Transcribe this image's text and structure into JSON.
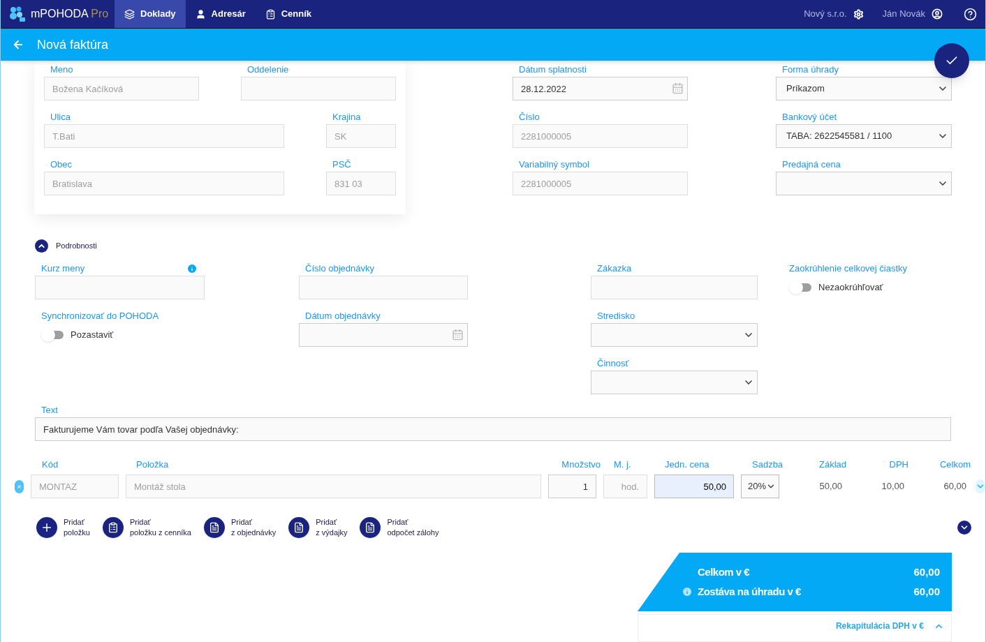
{
  "nav": {
    "logo": {
      "name": "mPOHODA",
      "suffix": "Pro"
    },
    "tabs": [
      {
        "label": "Doklady",
        "selected": true
      },
      {
        "label": "Adresár",
        "selected": false
      },
      {
        "label": "Cenník",
        "selected": false
      }
    ],
    "company": "Nový s.r.o.",
    "user": "Ján Novák"
  },
  "header": {
    "title": "Nová faktúra"
  },
  "customer": {
    "rows": [
      [
        {
          "label": "Meno",
          "kind": "text",
          "value": "Božena Kačíková",
          "disabled": true
        },
        {
          "label": "Oddelenie",
          "kind": "text"
        }
      ],
      [
        {
          "label": "Ulica",
          "kind": "text",
          "value": "T.Bati",
          "disabled": true
        },
        {
          "label": "Krajina",
          "kind": "text",
          "value": "SK",
          "disabled": true
        }
      ],
      [
        {
          "label": "Obec",
          "kind": "text",
          "value": "Bratislava",
          "disabled": true
        },
        {
          "label": "PSČ",
          "kind": "text",
          "value": "831 03",
          "disabled": true
        }
      ]
    ]
  },
  "document": [
    {
      "label": "Dátum splatnosti",
      "kind": "date",
      "value": "28.12.2022",
      "disabled": false
    },
    {
      "label": "Číslo",
      "kind": "text",
      "value": "2281000005",
      "disabled": true
    },
    {
      "label": "Variabilný symbol",
      "kind": "text",
      "value": "2281000005",
      "disabled": true
    }
  ],
  "payment": [
    {
      "label": "Forma úhrady",
      "kind": "select",
      "value": "Príkazom"
    },
    {
      "label": "Bankový účet",
      "kind": "select",
      "value": "TABA: 2622545581 / 1100"
    },
    {
      "label": "Predajná cena",
      "kind": "select"
    }
  ],
  "details": {
    "title": "Podrobnosti",
    "expanded": true,
    "columns": [
      [
        {
          "label": "Kurz meny",
          "kind": "text",
          "info": true
        },
        {
          "label": "Synchronizovať do POHODA",
          "kind": "toggle",
          "toggle_label": "Pozastaviť",
          "on": false
        }
      ],
      [
        {
          "label": "Číslo objednávky",
          "kind": "text"
        },
        {
          "label": "Dátum objednávky",
          "kind": "date"
        }
      ],
      [
        {
          "label": "Zákazka",
          "kind": "text"
        },
        {
          "label": "Stredisko",
          "kind": "select"
        },
        {
          "label": "Činnosť",
          "kind": "select"
        }
      ],
      [
        {
          "label": "Zaokrúhlenie celkovej čiastky",
          "kind": "toggle",
          "toggle_label": "Nezaokrúhľovať",
          "on": false
        }
      ]
    ]
  },
  "text_field": {
    "label": "Text",
    "value": "Fakturujeme Vám tovar podľa Vašej objednávky:"
  },
  "items": {
    "columns": [
      "Kód",
      "Položka",
      "Množstvo",
      "M. j.",
      "Jedn. cena",
      "Sadzba",
      "Základ",
      "DPH",
      "Celkom"
    ],
    "rows": [
      {
        "code": "MONTAZ",
        "name": "Montáž stola",
        "quantity": "1",
        "unit": "hod.",
        "price": "50,00",
        "price_focused": true,
        "rate": "20%",
        "base": "50,00",
        "vat": "10,00",
        "total": "60,00",
        "expanded": false
      }
    ]
  },
  "add_actions": [
    {
      "kind": "plus",
      "line1": "Pridať",
      "line2": "položku"
    },
    {
      "kind": "clipboard",
      "line1": "Pridať",
      "line2": "položku z cenníka"
    },
    {
      "kind": "document",
      "line1": "Pridať",
      "line2": "z objednávky"
    },
    {
      "kind": "document",
      "line1": "Pridať",
      "line2": "z výdajky"
    },
    {
      "kind": "document",
      "line1": "Pridať",
      "line2": "odpočet zálohy"
    }
  ],
  "more_expanded": false,
  "totals": [
    {
      "label": "Celkom v €",
      "value": "60,00",
      "info": false
    },
    {
      "label": "Zostáva na úhradu v €",
      "value": "60,00",
      "info": true
    }
  ],
  "recap": {
    "label": "Rekapitulácia DPH v €",
    "expanded": true
  }
}
